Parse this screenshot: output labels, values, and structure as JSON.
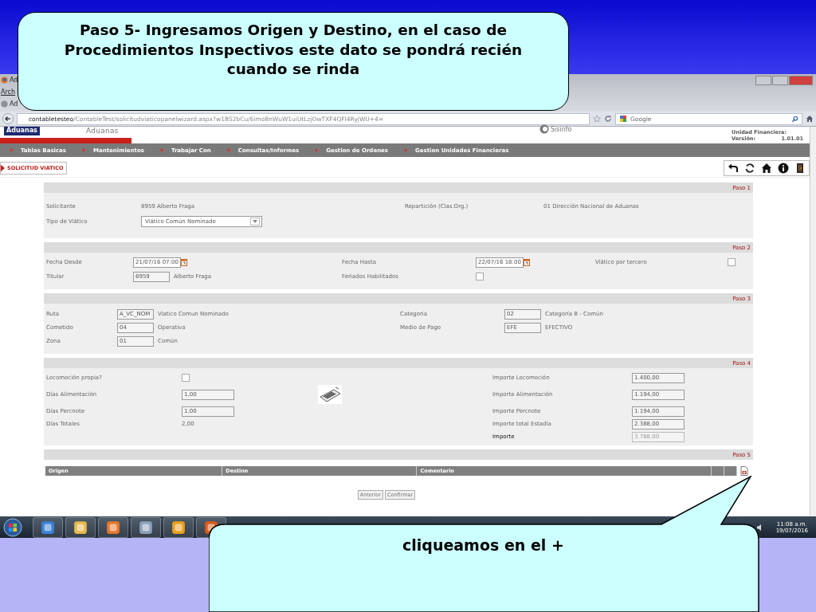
{
  "callouts": [
    {
      "text": "Paso 5- Ingresamos Origen y Destino, en el caso de Procedimientos Inspectivos  este dato se pondrá recién cuando se rinda"
    },
    {
      "text": "cliqueamos en el +"
    }
  ],
  "browser": {
    "window_title": "Ad",
    "menu_label": "Arch",
    "tab_title": "Ad",
    "url_host": "contabletesteo",
    "url_path": "/ContableTest/solicitudviaticopanelwizard.aspx?w1BS2bCu/6imo8nWuW1uiUtLzjOwTXF4QFI4RyjWU+4=",
    "search_placeholder": "Google"
  },
  "app": {
    "logo_badge": "Aduanas",
    "title": "Aduanas",
    "brand": "Sisinfo",
    "unit_label": "Unidad Financiera:",
    "version_label": "Versión:",
    "version": "1.01.01",
    "menu": [
      "Tablas Basicas",
      "Mantenimientos",
      "Trabajar Con",
      "Consultas/Informes",
      "Gestion de Ordenes",
      "Gestion Unidades Financieras"
    ],
    "page_title": "SOLICITUD VIATICO"
  },
  "steps": [
    {
      "label": "Paso 1",
      "rows": [
        {
          "left": {
            "label": "Solicitante",
            "items": [
              {
                "kind": "text",
                "text": "8959   Alberto Fraga"
              }
            ]
          },
          "right": {
            "label": "Repartición (Clas.Org.)",
            "items": [
              {
                "kind": "text",
                "text": "01  Dirección Nacional de Aduanas"
              }
            ]
          }
        },
        {
          "left": {
            "label": "Tipo de Viático",
            "items": [
              {
                "kind": "select",
                "value": "Viático Común Nominado"
              }
            ]
          }
        }
      ]
    },
    {
      "label": "Paso 2",
      "rows": [
        {
          "left": {
            "label": "Fecha Desde",
            "items": [
              {
                "kind": "date",
                "value": "21/07/16 07:00"
              }
            ]
          },
          "right": {
            "label": "Fecha Hasta",
            "items": [
              {
                "kind": "date",
                "value": "22/07/16 18:00"
              }
            ]
          },
          "far": {
            "label": "Viático por tercero",
            "items": [
              {
                "kind": "checkbox",
                "checked": false
              }
            ]
          }
        },
        {
          "left": {
            "label": "Titular",
            "items": [
              {
                "kind": "input",
                "value": "8959",
                "disabled": false
              },
              {
                "kind": "text",
                "text": "Alberto Fraga"
              }
            ]
          },
          "right": {
            "label": "Feriados Habilitados",
            "items": [
              {
                "kind": "checkbox",
                "checked": false
              }
            ]
          }
        }
      ]
    },
    {
      "label": "Paso 3",
      "rows": [
        {
          "left": {
            "label": "Ruta",
            "items": [
              {
                "kind": "input",
                "value": "A_VC_NOM",
                "disabled": false
              },
              {
                "kind": "text",
                "text": "Viatico Comun Nominado"
              }
            ]
          },
          "right": {
            "label": "Categoria",
            "items": [
              {
                "kind": "input",
                "value": "02",
                "disabled": false
              },
              {
                "kind": "text",
                "text": "Categoría B - Común"
              }
            ]
          }
        },
        {
          "left": {
            "label": "Cometido",
            "items": [
              {
                "kind": "input",
                "value": "04",
                "disabled": false
              },
              {
                "kind": "text",
                "text": "Operativa"
              }
            ]
          },
          "right": {
            "label": "Medio de Pago",
            "items": [
              {
                "kind": "input",
                "value": "EFE",
                "disabled": false
              },
              {
                "kind": "text",
                "text": "EFECTIVO"
              }
            ]
          }
        },
        {
          "left": {
            "label": "Zona",
            "items": [
              {
                "kind": "input",
                "value": "01",
                "disabled": false
              },
              {
                "kind": "text",
                "text": "Común"
              }
            ]
          }
        }
      ]
    },
    {
      "label": "Paso 4",
      "rows": [
        {
          "left": {
            "label": "Locomoción propia?",
            "items": [
              {
                "kind": "checkbox",
                "checked": false
              }
            ]
          },
          "right": {
            "label": "Importe Locomoción",
            "items": [
              {
                "kind": "input",
                "value": "1.400,00",
                "disabled": false
              }
            ]
          }
        },
        {
          "left": {
            "label": "Días Alimentación",
            "items": [
              {
                "kind": "input",
                "value": "1,00",
                "disabled": false
              },
              {
                "kind": "calculator"
              }
            ]
          },
          "right": {
            "label": "Importe Alimentación",
            "items": [
              {
                "kind": "input",
                "value": "1.194,00",
                "disabled": false
              }
            ]
          }
        },
        {
          "left": {
            "label": "Días Percnote",
            "items": [
              {
                "kind": "input",
                "value": "1,00",
                "disabled": false
              }
            ]
          },
          "right": {
            "label": "Importe Percnote",
            "items": [
              {
                "kind": "input",
                "value": "1.194,00",
                "disabled": false
              }
            ]
          }
        },
        {
          "left": {
            "label": "Días Totales",
            "items": [
              {
                "kind": "text",
                "text": "2,00"
              }
            ]
          },
          "right": {
            "label": "Importe total Estadía",
            "items": [
              {
                "kind": "input",
                "value": "2.388,00",
                "disabled": false
              }
            ]
          }
        },
        {
          "right": {
            "label": "Importe",
            "emphasis": true,
            "items": [
              {
                "kind": "input",
                "value": "3.788,00",
                "disabled": true
              }
            ]
          }
        }
      ]
    }
  ],
  "grid": {
    "label": "Paso 5",
    "columns": [
      "Origen",
      "Destino",
      "Comentario"
    ]
  },
  "buttons": [
    "Anterior",
    "Confirmar"
  ],
  "taskbar": {
    "time": "11:08 a.m.",
    "date": "19/07/2016"
  }
}
